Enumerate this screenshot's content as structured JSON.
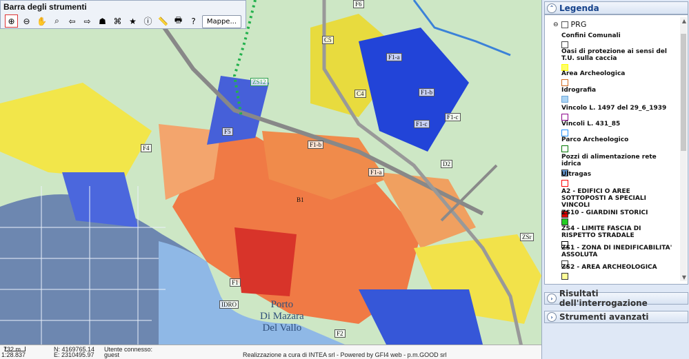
{
  "toolbar": {
    "title": "Barra degli strumenti",
    "maps_button": "Mappe..."
  },
  "map": {
    "labels": [
      "C5",
      "F1-a",
      "F6",
      "ZS12",
      "C4",
      "F1-c",
      "F1-c",
      "F1-b",
      "F4",
      "F5",
      "F1-b",
      "F1-a",
      "D2",
      "B1",
      "ZSr",
      "F1",
      "IDRO",
      "F2"
    ],
    "water": {
      "line1": "Porto",
      "line2": "Di Mazara",
      "line3": "Del Vallo"
    }
  },
  "status": {
    "scale": "732 m",
    "ratio": "1:28.837",
    "north": "N: 4169765.14",
    "east": "E: 2310495.97",
    "user_label": "Utente connesso:",
    "user_value": "guest",
    "credit": "Realizzazione a cura di INTEA srl - Powered by GFI4 web - p.m.GOOD srl"
  },
  "legend": {
    "title": "Legenda",
    "group": "PRG",
    "items": [
      {
        "label": "Confini Comunali",
        "color": "#ffffff",
        "border": "#444444"
      },
      {
        "label": "Oasi di protezione ai sensi del T.U. sulla caccia",
        "color": "#ffff66",
        "border": "#ffff00"
      },
      {
        "label": "Area Archeologica",
        "color": "#ffffff",
        "border": "#d2691e"
      },
      {
        "label": "Idrografia",
        "color": "#aad4f5",
        "border": "#6fa7d8"
      },
      {
        "label": "Vincolo L. 1497 del 29_6_1939",
        "color": "#ffffff",
        "border": "#8b008b"
      },
      {
        "label": "Vincoli L. 431_85",
        "color": "#ffffff",
        "border": "#1e90ff"
      },
      {
        "label": "Parco Archeologico",
        "color": "#ffffff",
        "border": "#007700"
      },
      {
        "label": "Pozzi di alimentazione rete idrica",
        "color": "#6fa7e8",
        "border": "#333333"
      },
      {
        "label": "Ultragas",
        "color": "#ffffff",
        "border": "#ff0000"
      },
      {
        "label": "A2 - EDIFICI O AREE SOTTOPOSTI A SPECIALI VINCOLI",
        "color": "#dd0000",
        "border": "#333333"
      },
      {
        "label": "ZS10 - GIARDINI STORICI",
        "color": "#22cc22",
        "border": "#333333"
      },
      {
        "label": "ZS4 - LIMITE FASCIA DI RISPETTO STRADALE",
        "color": "#ffffff",
        "border": "#000000"
      },
      {
        "label": "ZS1 - ZONA DI INEDIFICABILITA' ASSOLUTA",
        "color": "#ffffff",
        "border": "#333333"
      },
      {
        "label": "ZS2 - AREA ARCHEOLOGICA",
        "color": "#ffff99",
        "border": "#333333"
      }
    ]
  },
  "panels": {
    "results": "Risultati dell'interrogazione",
    "tools": "Strumenti avanzati"
  }
}
